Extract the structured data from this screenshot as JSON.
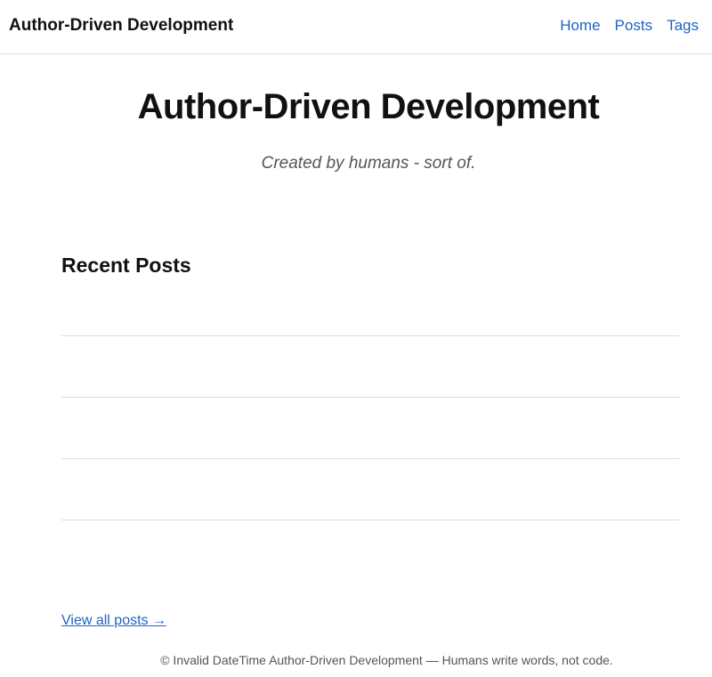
{
  "header": {
    "site_title": "Author-Driven Development",
    "nav": [
      {
        "label": "Home"
      },
      {
        "label": "Posts"
      },
      {
        "label": "Tags"
      }
    ]
  },
  "hero": {
    "title": "Author-Driven Development",
    "tagline": "Created by humans - sort of."
  },
  "recent_posts": {
    "heading": "Recent Posts",
    "view_all_label": "View all posts →"
  },
  "footer": {
    "text": "© Invalid DateTime Author-Driven Development — Humans write words, not code."
  },
  "colors": {
    "link": "#1f63c4",
    "text": "#111111",
    "muted": "#555555",
    "divider": "#dddddd"
  }
}
